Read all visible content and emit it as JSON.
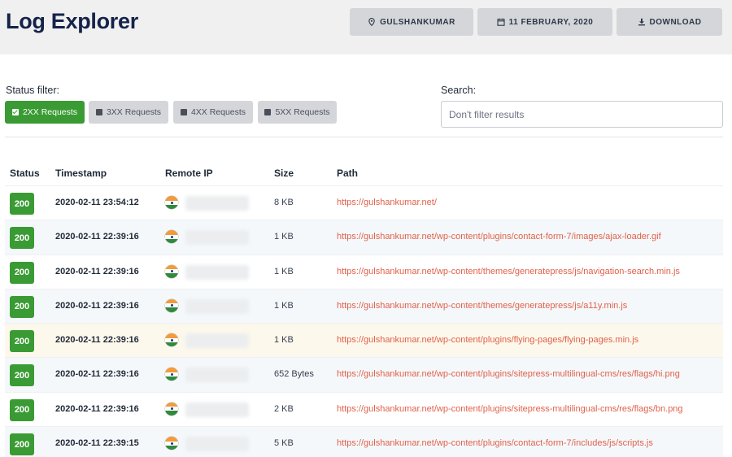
{
  "header": {
    "title": "Log Explorer",
    "site_label": "GULSHANKUMAR",
    "date_label": "11 FEBRUARY, 2020",
    "download_label": "DOWNLOAD"
  },
  "filters": {
    "label": "Status filter:",
    "buttons": [
      {
        "label": "2XX Requests",
        "active": true
      },
      {
        "label": "3XX Requests",
        "active": false
      },
      {
        "label": "4XX Requests",
        "active": false
      },
      {
        "label": "5XX Requests",
        "active": false
      }
    ]
  },
  "search": {
    "label": "Search:",
    "placeholder": "Don't filter results",
    "value": ""
  },
  "table": {
    "columns": [
      "Status",
      "Timestamp",
      "Remote IP",
      "Size",
      "Path"
    ],
    "rows": [
      {
        "status": "200",
        "timestamp": "2020-02-11 23:54:12",
        "ip": "",
        "size": "8 KB",
        "path": "https://gulshankumar.net/"
      },
      {
        "status": "200",
        "timestamp": "2020-02-11 22:39:16",
        "ip": "",
        "size": "1 KB",
        "path": "https://gulshankumar.net/wp-content/plugins/contact-form-7/images/ajax-loader.gif"
      },
      {
        "status": "200",
        "timestamp": "2020-02-11 22:39:16",
        "ip": "",
        "size": "1 KB",
        "path": "https://gulshankumar.net/wp-content/themes/generatepress/js/navigation-search.min.js"
      },
      {
        "status": "200",
        "timestamp": "2020-02-11 22:39:16",
        "ip": "",
        "size": "1 KB",
        "path": "https://gulshankumar.net/wp-content/themes/generatepress/js/a11y.min.js"
      },
      {
        "status": "200",
        "timestamp": "2020-02-11 22:39:16",
        "ip": "",
        "size": "1 KB",
        "path": "https://gulshankumar.net/wp-content/plugins/flying-pages/flying-pages.min.js"
      },
      {
        "status": "200",
        "timestamp": "2020-02-11 22:39:16",
        "ip": "",
        "size": "652 Bytes",
        "path": "https://gulshankumar.net/wp-content/plugins/sitepress-multilingual-cms/res/flags/hi.png"
      },
      {
        "status": "200",
        "timestamp": "2020-02-11 22:39:16",
        "ip": "",
        "size": "2 KB",
        "path": "https://gulshankumar.net/wp-content/plugins/sitepress-multilingual-cms/res/flags/bn.png"
      },
      {
        "status": "200",
        "timestamp": "2020-02-11 22:39:15",
        "ip": "",
        "size": "5 KB",
        "path": "https://gulshankumar.net/wp-content/plugins/contact-form-7/includes/js/scripts.js"
      }
    ]
  },
  "colors": {
    "accent_green": "#3a9b34",
    "link_color": "#e0614a",
    "title_color": "#15234a"
  },
  "icons": {
    "site": "map-pin-icon",
    "date": "calendar-icon",
    "download": "download-icon",
    "flag": "india-flag-icon"
  }
}
